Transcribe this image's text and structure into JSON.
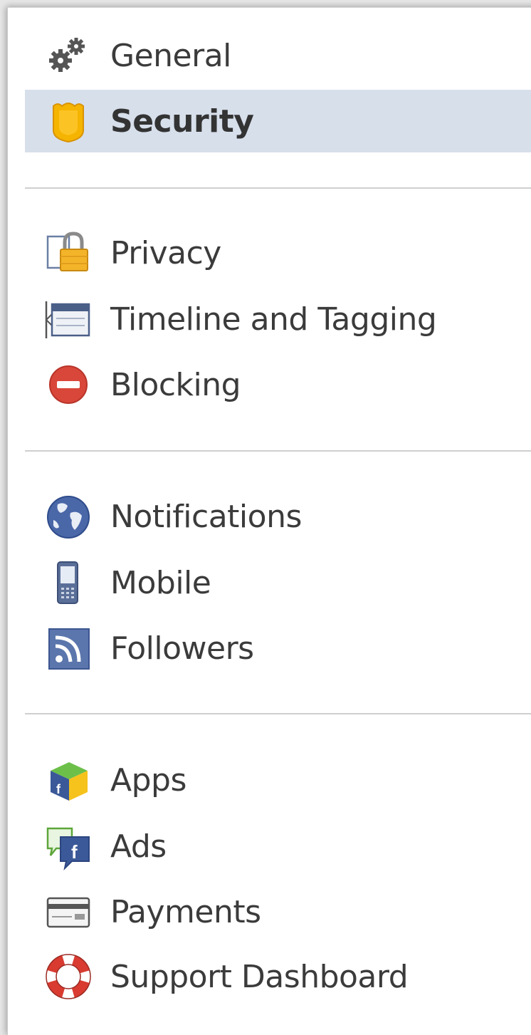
{
  "sidebar": {
    "selected": "Security",
    "colors": {
      "selected_bg": "#d7dfeb",
      "divider": "#cfcfcf",
      "text": "#3b3b3b"
    },
    "groups": [
      {
        "items": [
          {
            "label": "General",
            "icon": "gears-icon"
          },
          {
            "label": "Security",
            "icon": "shield-icon"
          }
        ]
      },
      {
        "items": [
          {
            "label": "Privacy",
            "icon": "lock-icon"
          },
          {
            "label": "Timeline and Tagging",
            "icon": "timeline-icon"
          },
          {
            "label": "Blocking",
            "icon": "blocking-icon"
          }
        ]
      },
      {
        "items": [
          {
            "label": "Notifications",
            "icon": "globe-icon"
          },
          {
            "label": "Mobile",
            "icon": "mobile-phone-icon"
          },
          {
            "label": "Followers",
            "icon": "rss-icon"
          }
        ]
      },
      {
        "items": [
          {
            "label": "Apps",
            "icon": "apps-cube-icon"
          },
          {
            "label": "Ads",
            "icon": "ads-icon"
          },
          {
            "label": "Payments",
            "icon": "credit-card-icon"
          },
          {
            "label": "Support Dashboard",
            "icon": "lifebuoy-icon"
          }
        ]
      }
    ]
  }
}
